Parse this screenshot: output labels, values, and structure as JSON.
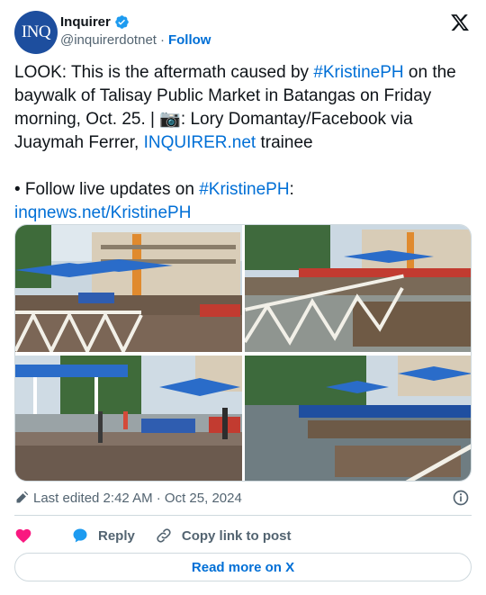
{
  "author": {
    "display_name": "Inquirer",
    "handle": "@inquirerdotnet",
    "follow_label": "Follow",
    "avatar_text": "INQ",
    "verified": true
  },
  "post": {
    "line1_a": "LOOK: This is the aftermath caused by ",
    "line1_tag": "#KristinePH",
    "line1_b": " on the baywalk of Talisay Public Market in Batangas on Friday morning, Oct. 25. | ",
    "line1_emoji": "📷",
    "line1_c": ": Lory Domantay/Facebook via Juaymah Ferrer, ",
    "line1_link": "INQUIRER.net",
    "line1_d": " trainee",
    "line2_a": "• Follow live updates on ",
    "line2_tag": "#KristinePH",
    "line2_b": ":",
    "line3_link": "inqnews.net/KristinePH"
  },
  "media": {
    "photos": [
      {
        "icon": "photo-baywalk-railing"
      },
      {
        "icon": "photo-debris-railing"
      },
      {
        "icon": "photo-market-crowd"
      },
      {
        "icon": "photo-debris-water"
      }
    ]
  },
  "meta": {
    "edited": "Last edited 2:42 AM · Oct 25, 2024"
  },
  "actions": {
    "reply_label": "Reply",
    "copy_label": "Copy link to post",
    "read_more_label": "Read more on X"
  },
  "colors": {
    "accent": "#006fd6",
    "brand_avatar": "#1d4e9e",
    "heart": "#f91880",
    "muted": "#536471",
    "border": "#cfd9de"
  }
}
